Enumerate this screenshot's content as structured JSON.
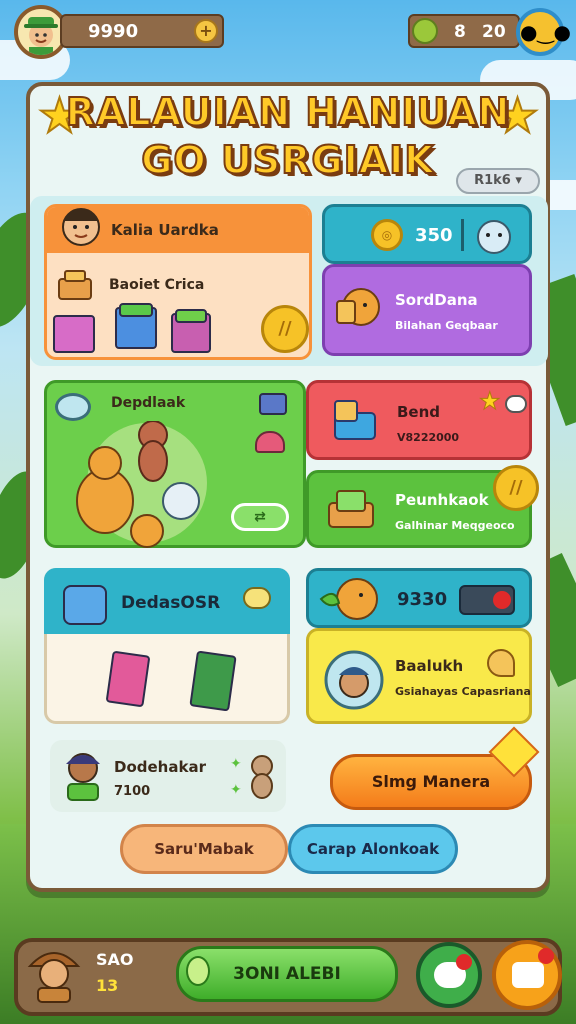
{
  "hud": {
    "coins": "9990",
    "gems_a": "8",
    "gems_b": "20"
  },
  "title": {
    "line1": "RALAUIAN HANIUAN",
    "line2": "GO USRGIAIK"
  },
  "filter": {
    "label": "R1k6"
  },
  "cards": {
    "profile": {
      "name": "Kalia Uardka"
    },
    "basket": {
      "label": "Baoiet Crica"
    },
    "score": {
      "value": "350"
    },
    "side1": {
      "title": "SordDana",
      "subtitle": "Bilahan Geqbaar"
    },
    "pets": {
      "title": "Depdlaak"
    },
    "bend": {
      "title": "Bend",
      "subtitle": "V8222000"
    },
    "punch": {
      "title": "Peunhkaok",
      "subtitle": "Galhinar Meqgeoco"
    },
    "decals": {
      "title": "DedasOSR"
    },
    "timer": {
      "value": "9330"
    },
    "buddy": {
      "title": "Baalukh",
      "subtitle": "Gsiahayas Capasriana"
    },
    "player": {
      "name": "Dodehakar",
      "score": "7100"
    }
  },
  "buttons": {
    "sing_manera": "Slmg Manera",
    "start_match": "Saru'Mabak",
    "carap": "Carap Alonkoak",
    "bottom_main": "3ONI ALEBI"
  },
  "bottom": {
    "count_a": "SAO",
    "count_b": "13"
  },
  "colors": {
    "orange": "#f7923a",
    "teal": "#2fb3c9",
    "purple": "#b06be0",
    "green": "#5cc23e",
    "red": "#ef5a5e",
    "yellow": "#f9e94a",
    "gold": "#ffc928"
  }
}
